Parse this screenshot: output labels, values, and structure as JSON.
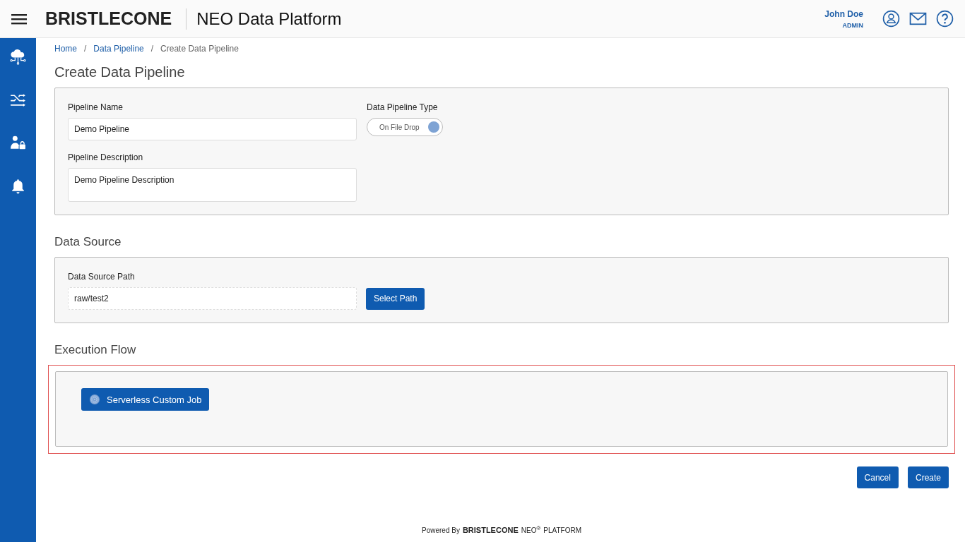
{
  "header": {
    "logo": "BRISTLECONE",
    "title": "NEO Data Platform",
    "user_name": "John Doe",
    "user_role": "ADMIN"
  },
  "sidebar": {
    "items": [
      {
        "kind": "cloud"
      },
      {
        "kind": "shuffle"
      },
      {
        "kind": "user-lock"
      },
      {
        "kind": "bell"
      }
    ]
  },
  "breadcrumb": [
    {
      "label": "Home",
      "current": false
    },
    {
      "separator": "/",
      "label": "Data Pipeline",
      "current": false
    },
    {
      "separator": "/",
      "label": "Create Data Pipeline",
      "current": true
    }
  ],
  "page_title": "Create Data Pipeline",
  "pipeline": {
    "name_label": "Pipeline Name",
    "name_value": "Demo Pipeline",
    "type_label": "Data Pipeline Type",
    "type_toggle": {
      "label": "On File Drop",
      "on": true
    },
    "description_label": "Pipeline Description",
    "description_value": "Demo Pipeline Description"
  },
  "data_source": {
    "title": "Data Source",
    "path_label": "Data Source Path",
    "path_value": "raw/test2",
    "select_button": "Select Path"
  },
  "execution_flow": {
    "title": "Execution Flow",
    "highlighted": true,
    "job_button": "Serverless Custom Job"
  },
  "actions": [
    "Cancel",
    "Create"
  ],
  "footer": {
    "powered_by": "Powered By",
    "logo": "BRISTLECONE",
    "product": "NEO",
    "mark": "®",
    "platform": "PLATFORM"
  }
}
